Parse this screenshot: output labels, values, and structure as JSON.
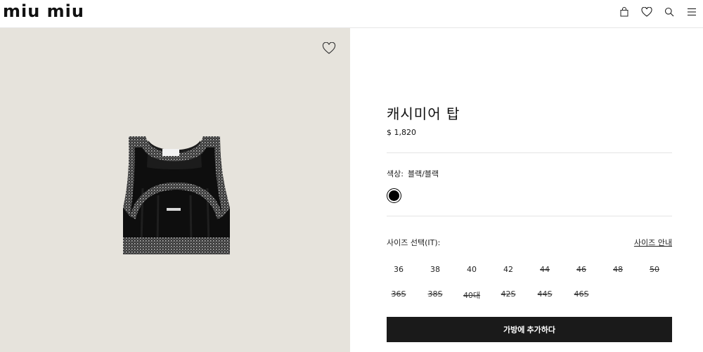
{
  "header": {
    "logo": "miu miu",
    "icons": [
      "bag-icon",
      "heart-icon",
      "search-icon",
      "menu-icon"
    ]
  },
  "product": {
    "title": "캐시미어 탑",
    "price": "$ 1,820",
    "color_label": "색상:",
    "color_value": "블랙/블랙",
    "swatch_color": "#000000",
    "size_label": "사이즈 선택(IT):",
    "size_guide": "사이즈 안내",
    "sizes_row1": [
      {
        "label": "36",
        "available": true
      },
      {
        "label": "38",
        "available": true
      },
      {
        "label": "40",
        "available": true
      },
      {
        "label": "42",
        "available": true
      },
      {
        "label": "44",
        "available": false
      },
      {
        "label": "46",
        "available": false
      },
      {
        "label": "48",
        "available": false
      },
      {
        "label": "50",
        "available": false
      }
    ],
    "sizes_row2": [
      {
        "label": "36S",
        "available": false
      },
      {
        "label": "38S",
        "available": false
      },
      {
        "label": "40대",
        "available": false
      },
      {
        "label": "42S",
        "available": false
      },
      {
        "label": "44S",
        "available": false
      },
      {
        "label": "46S",
        "available": false
      }
    ],
    "add_to_bag": "가방에 추가하다"
  },
  "colors": {
    "image_bg": "#e6e3dc",
    "button_bg": "#1a1a1a"
  }
}
